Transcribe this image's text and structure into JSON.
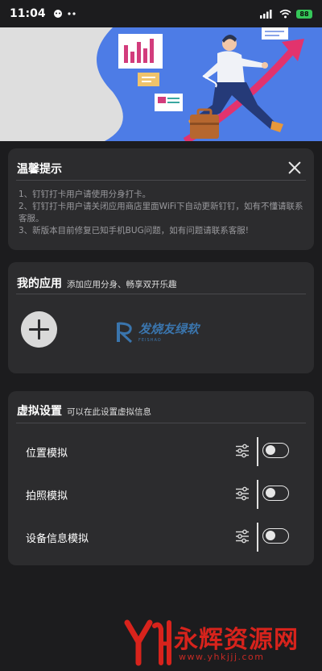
{
  "status_bar": {
    "time": "11:04",
    "battery": "88"
  },
  "notice": {
    "title": "温馨提示",
    "lines": [
      "1、钉钉打卡用户请使用分身打卡。",
      "2、钉钉打卡用户请关闭应用商店里面WiFi下自动更新钉钉，如有不懂请联系客服。",
      "3、新版本目前修复已知手机BUG问题，如有问题请联系客服!"
    ]
  },
  "my_apps": {
    "title": "我的应用",
    "subtitle": "添加应用分身、畅享双开乐趣",
    "watermark": "发烧友绿软",
    "watermark_sub": "FEISHAO"
  },
  "virtual_settings": {
    "title": "虚拟设置",
    "subtitle": "可以在此设置虚拟信息",
    "items": [
      {
        "label": "位置模拟",
        "enabled": false
      },
      {
        "label": "拍照模拟",
        "enabled": false
      },
      {
        "label": "设备信息模拟",
        "enabled": false
      }
    ]
  },
  "footer": {
    "name": "永辉资源网",
    "url": "www.yhkjjj.com",
    "mark": "YH"
  },
  "icons": {
    "close": "close-icon",
    "add": "plus-icon",
    "settings": "sliders-icon",
    "signal": "signal-icon",
    "wifi": "wifi-icon",
    "battery": "battery-icon"
  },
  "colors": {
    "background": "#1c1c1e",
    "card": "#2c2c2e",
    "banner_blue": "#4d7ce6",
    "footer_red": "#d8231c",
    "battery_green": "#35c759"
  }
}
